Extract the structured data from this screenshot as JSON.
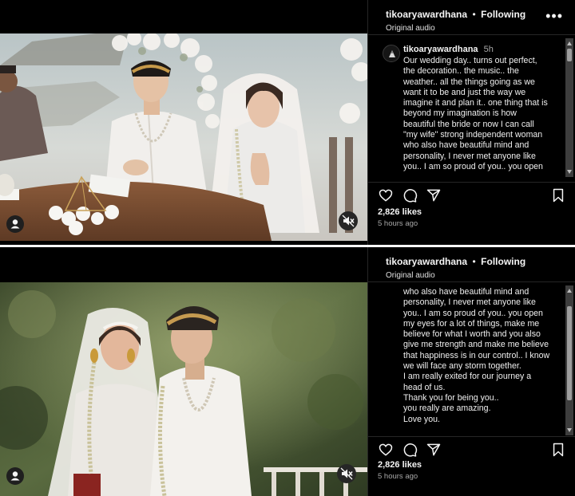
{
  "posts": [
    {
      "header": {
        "username": "tikoaryawardhana",
        "separator": "•",
        "follow_status": "Following",
        "audio": "Original audio"
      },
      "caption": {
        "username": "tikoaryawardhana",
        "time": "5h",
        "lines": [
          "Our wedding day.. turns out perfect,",
          "the decoration.. the music.. the",
          "weather.. all the things going as we",
          "want it to be and just the way we",
          "imagine it and plan it.. one thing that is",
          "beyond my imagination is how",
          "beautiful the bride or now I can call",
          "\"my wife\" strong independent woman",
          "who also have beautiful mind and",
          "personality, I never met anyone like",
          "you.. I am so proud of you.. you open"
        ]
      },
      "likes": "2,826 likes",
      "time_ago": "5 hours ago"
    },
    {
      "header": {
        "username": "tikoaryawardhana",
        "separator": "•",
        "follow_status": "Following",
        "audio": "Original audio"
      },
      "caption": {
        "lines": [
          "who also have beautiful mind and",
          "personality, I never met anyone like",
          "you.. I am so proud of you.. you open",
          "my eyes for a lot of things, make me",
          "believe for what I worth and you also",
          "give me strength and make me believe",
          "that happiness is in our control.. I know",
          "we will face any storm together.",
          "I am really exited for our journey a",
          "head of us.",
          "Thank you for being you..",
          "you really are amazing.",
          "Love you."
        ]
      },
      "likes": "2,826 likes",
      "time_ago": "5 hours ago"
    }
  ],
  "icons": {
    "more": "more-options-icon",
    "like": "heart-icon",
    "comment": "comment-icon",
    "share": "send-icon",
    "save": "bookmark-icon",
    "tag": "user-tag-icon",
    "mute": "muted-speaker-icon"
  },
  "colors": {
    "background": "#000000",
    "text": "#f5f5f5",
    "secondary_text": "#a8a8a8",
    "divider": "#262626"
  }
}
